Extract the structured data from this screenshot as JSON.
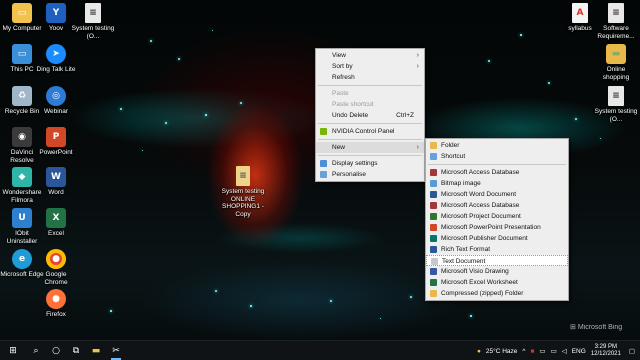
{
  "desktop": {
    "icons_left_col1": [
      {
        "label": "My Computer",
        "icon": "computer-icon",
        "color": "#f2c14e"
      },
      {
        "label": "This PC",
        "icon": "this-pc-icon",
        "color": "#3b8ed8"
      },
      {
        "label": "Recycle Bin",
        "icon": "recycle-bin-icon",
        "color": "#9fb7c9"
      },
      {
        "label": "DaVinci Resolve",
        "icon": "davinci-resolve-icon",
        "color": "#3a3a3a"
      },
      {
        "label": "Wondershare Filmora",
        "icon": "filmora-icon",
        "color": "#2fb5a8"
      },
      {
        "label": "IObit Uninstaller",
        "icon": "iobit-uninstaller-icon",
        "color": "#2e7fd0"
      },
      {
        "label": "Microsoft Edge",
        "icon": "edge-icon",
        "color": "#1f9cd8"
      }
    ],
    "icons_left_col2": [
      {
        "label": "Yoov",
        "icon": "yoov-icon",
        "color": "#1e5fbf"
      },
      {
        "label": "Ding Talk Lite",
        "icon": "dingtalk-icon",
        "color": "#1a8cff"
      },
      {
        "label": "Webinar",
        "icon": "webinar-icon",
        "color": "#2d7bd6"
      },
      {
        "label": "PowerPoint",
        "icon": "powerpoint-icon",
        "color": "#d24726"
      },
      {
        "label": "Word",
        "icon": "word-icon",
        "color": "#2b579a"
      },
      {
        "label": "Excel",
        "icon": "excel-icon",
        "color": "#217346"
      },
      {
        "label": "Google Chrome",
        "icon": "chrome-icon",
        "color": "#e94235"
      },
      {
        "label": "Firefox",
        "icon": "firefox-icon",
        "color": "#ff7139"
      }
    ],
    "system_testing_top": "System testing (O...",
    "system_testing_center": "System testing ONLINE SHOPPING1 - Copy",
    "icons_right": [
      {
        "label": "syllabus",
        "icon": "pdf-icon",
        "color": "#d93025"
      },
      {
        "label": "Software Requireme...",
        "icon": "document-icon",
        "color": "#e8e8e8"
      },
      {
        "label": "Online shopping",
        "icon": "folder-icon",
        "color": "#e8b84a"
      },
      {
        "label": "System testing (O...",
        "icon": "document-icon",
        "color": "#e8e8e8"
      }
    ]
  },
  "context_menu": {
    "items": [
      {
        "label": "View",
        "arrow": true
      },
      {
        "label": "Sort by",
        "arrow": true
      },
      {
        "label": "Refresh"
      },
      {
        "sep": true
      },
      {
        "label": "Paste",
        "disabled": true
      },
      {
        "label": "Paste shortcut",
        "disabled": true
      },
      {
        "label": "Undo Delete",
        "shortcut": "Ctrl+Z"
      },
      {
        "sep": true
      },
      {
        "label": "NVIDIA Control Panel",
        "icon": "nvidia-icon"
      },
      {
        "sep": true
      },
      {
        "label": "New",
        "arrow": true,
        "highlighted": true
      },
      {
        "sep": true
      },
      {
        "label": "Display settings",
        "icon": "display-settings-icon"
      },
      {
        "label": "Personalise",
        "icon": "personalise-icon"
      }
    ]
  },
  "new_submenu": {
    "items": [
      {
        "label": "Folder",
        "icon": "folder-icon",
        "color": "#e8b84a"
      },
      {
        "label": "Shortcut",
        "icon": "shortcut-icon",
        "color": "#6aa0d8"
      },
      {
        "sep": true
      },
      {
        "label": "Microsoft Access Database",
        "icon": "access-icon",
        "color": "#a4373a"
      },
      {
        "label": "Bitmap image",
        "icon": "bitmap-icon",
        "color": "#5b9bd5"
      },
      {
        "label": "Microsoft Word Document",
        "icon": "word-doc-icon",
        "color": "#2b579a"
      },
      {
        "label": "Microsoft Access Database",
        "icon": "access-icon",
        "color": "#a4373a"
      },
      {
        "label": "Microsoft Project Document",
        "icon": "project-icon",
        "color": "#31752f"
      },
      {
        "label": "Microsoft PowerPoint Presentation",
        "icon": "powerpoint-doc-icon",
        "color": "#d24726"
      },
      {
        "label": "Microsoft Publisher Document",
        "icon": "publisher-icon",
        "color": "#077568"
      },
      {
        "label": "Rich Text Format",
        "icon": "rtf-icon",
        "color": "#2b579a"
      },
      {
        "label": "Text Document",
        "icon": "text-doc-icon",
        "color": "#c8c8c8",
        "hover": true
      },
      {
        "label": "Microsoft Visio Drawing",
        "icon": "visio-icon",
        "color": "#3955a3"
      },
      {
        "label": "Microsoft Excel Worksheet",
        "icon": "excel-doc-icon",
        "color": "#217346"
      },
      {
        "label": "Compressed (zipped) Folder",
        "icon": "zip-folder-icon",
        "color": "#e8b84a"
      }
    ]
  },
  "watermark": "Microsoft Bing",
  "taskbar": {
    "weather": "25°C  Haze",
    "language": "ENG",
    "time": "3:29 PM",
    "date": "12/12/2021"
  }
}
